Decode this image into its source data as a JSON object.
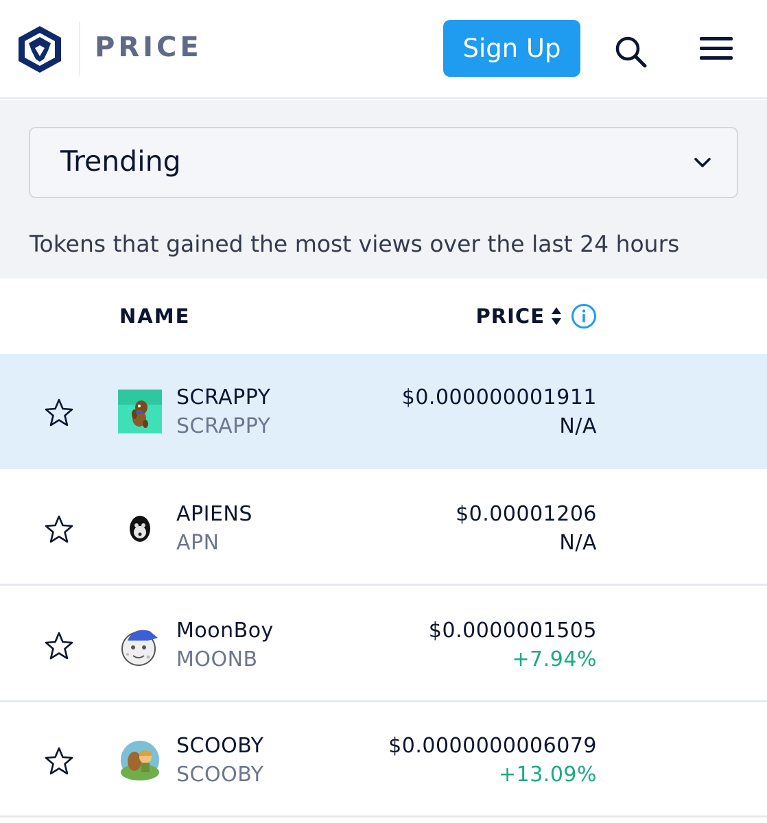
{
  "header": {
    "brand_text": "PRICE",
    "signup_label": "Sign Up",
    "logo_icon": "lion-shield-logo-icon",
    "search_icon": "search-icon",
    "menu_icon": "hamburger-menu-icon",
    "accent_color": "#1f9bf0"
  },
  "filter": {
    "selected": "Trending",
    "description": "Tokens that gained the most views over the last 24 hours"
  },
  "table": {
    "columns": {
      "name": "NAME",
      "price": "PRICE"
    },
    "rows": [
      {
        "name": "SCRAPPY",
        "symbol": "SCRAPPY",
        "price": "$0.000000001911",
        "change": "N/A",
        "change_direction": "none",
        "highlighted": true
      },
      {
        "name": "APIENS",
        "symbol": "APN",
        "price": "$0.00001206",
        "change": "N/A",
        "change_direction": "none",
        "highlighted": false
      },
      {
        "name": "MoonBoy",
        "symbol": "MOONB",
        "price": "$0.0000001505",
        "change": "+7.94%",
        "change_direction": "up",
        "highlighted": false
      },
      {
        "name": "SCOOBY",
        "symbol": "SCOOBY",
        "price": "$0.0000000006079",
        "change": "+13.09%",
        "change_direction": "up",
        "highlighted": false
      }
    ],
    "positive_color": "#1aaa84"
  }
}
